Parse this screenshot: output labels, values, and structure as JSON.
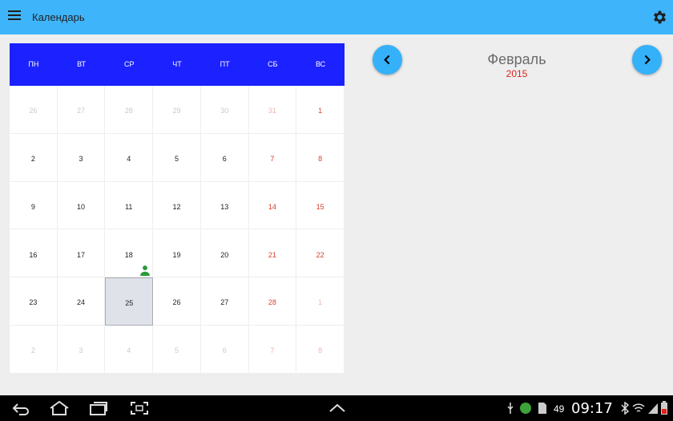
{
  "app": {
    "title": "Календарь"
  },
  "weekdays": [
    "ПН",
    "ВТ",
    "СР",
    "ЧТ",
    "ПТ",
    "СБ",
    "ВС"
  ],
  "month": {
    "name": "Февраль",
    "year": "2015"
  },
  "weeks": [
    [
      "26",
      "27",
      "28",
      "29",
      "30",
      "31",
      "1"
    ],
    [
      "2",
      "3",
      "4",
      "5",
      "6",
      "7",
      "8"
    ],
    [
      "9",
      "10",
      "11",
      "12",
      "13",
      "14",
      "15"
    ],
    [
      "16",
      "17",
      "18",
      "19",
      "20",
      "21",
      "22"
    ],
    [
      "23",
      "24",
      "25",
      "26",
      "27",
      "28",
      "1"
    ],
    [
      "2",
      "3",
      "4",
      "5",
      "6",
      "7",
      "8"
    ]
  ],
  "other_month": [
    [
      true,
      true,
      true,
      true,
      true,
      true,
      false
    ],
    [
      false,
      false,
      false,
      false,
      false,
      false,
      false
    ],
    [
      false,
      false,
      false,
      false,
      false,
      false,
      false
    ],
    [
      false,
      false,
      false,
      false,
      false,
      false,
      false
    ],
    [
      false,
      false,
      false,
      false,
      false,
      false,
      true
    ],
    [
      true,
      true,
      true,
      true,
      true,
      true,
      true
    ]
  ],
  "selected_day": "25",
  "event_day": "18",
  "colors": {
    "appbar": "#3eb4fb",
    "weekday_header": "#1b22ff",
    "weekend": "#e03b2c",
    "year": "#e0221c",
    "event": "#2a9a3a"
  },
  "statusbar": {
    "battery": "49",
    "time": "09:17"
  }
}
